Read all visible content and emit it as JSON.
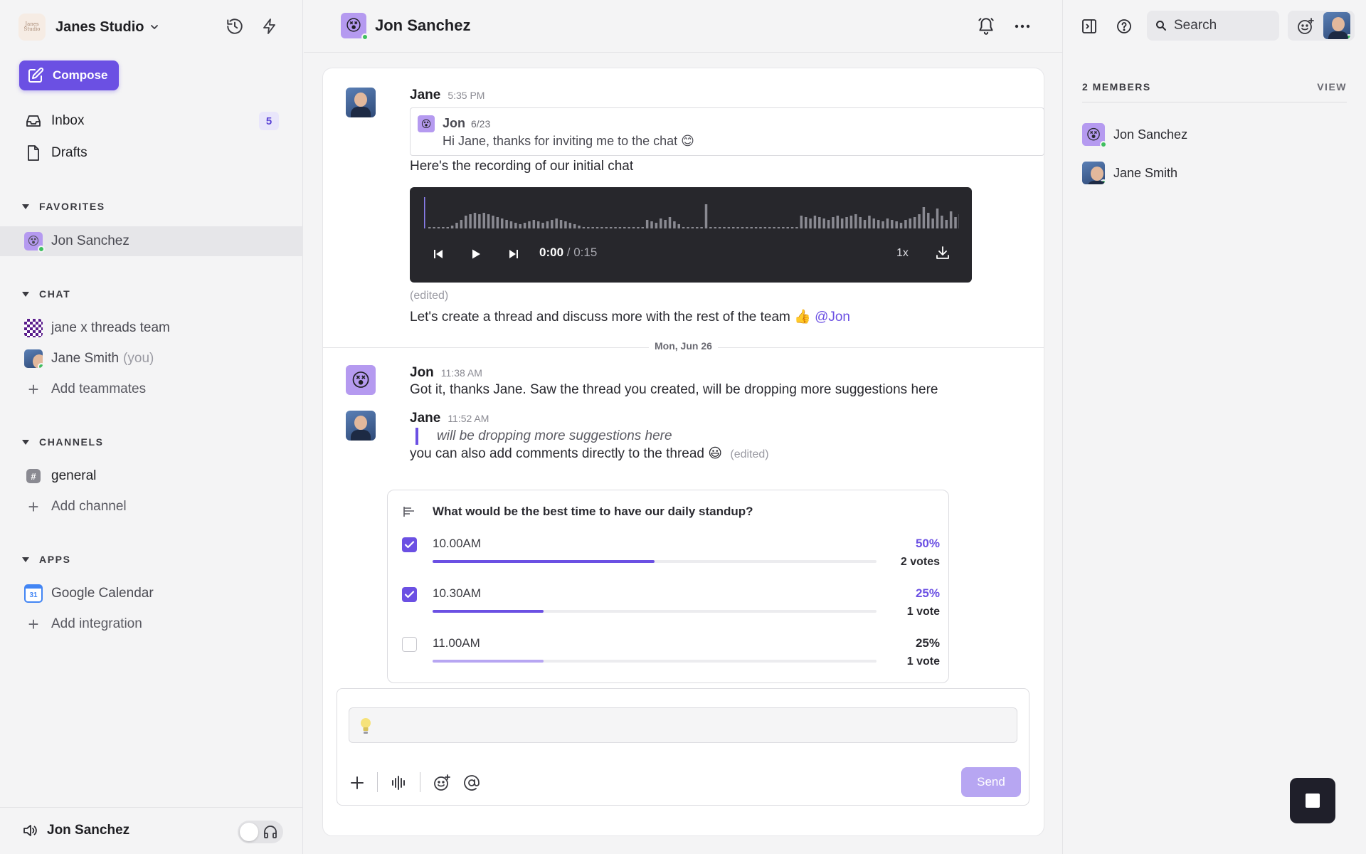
{
  "workspace": {
    "name": "Janes Studio",
    "logo_text": "Janes Studio"
  },
  "compose_label": "Compose",
  "nav": [
    {
      "label": "Inbox",
      "badge": "5"
    },
    {
      "label": "Drafts"
    }
  ],
  "sections": {
    "favorites": "FAVORITES",
    "chat": "CHAT",
    "channels": "CHANNELS",
    "apps": "APPS"
  },
  "favorites": [
    {
      "label": "Jon Sanchez"
    }
  ],
  "chats": [
    {
      "label": "jane x threads team"
    },
    {
      "label": "Jane Smith",
      "suffix": "(you)"
    }
  ],
  "add_teammates": "Add teammates",
  "channels": [
    {
      "label": "general"
    }
  ],
  "add_channel": "Add channel",
  "apps": [
    {
      "label": "Google Calendar",
      "icon_text": "31"
    }
  ],
  "add_integration": "Add integration",
  "footer": {
    "user": "Jon Sanchez"
  },
  "conversation": {
    "title": "Jon Sanchez"
  },
  "messages": {
    "m1": {
      "author": "Jane",
      "time": "5:35 PM",
      "quote": {
        "author": "Jon",
        "date": "6/23",
        "text": "Hi Jane, thanks for inviting me to the chat 😊"
      },
      "text": "Here's the recording of our initial chat",
      "player": {
        "current": "0:00",
        "total": "/ 0:15",
        "speed": "1x"
      },
      "edited": "(edited)",
      "text2": "Let's create a thread and discuss more with the rest of the team 👍",
      "mention": "@Jon"
    },
    "date_divider": "Mon, Jun 26",
    "m2": {
      "author": "Jon",
      "time": "11:38 AM",
      "text": "Got it, thanks Jane. Saw the thread you created, will be dropping more suggestions here"
    },
    "m3": {
      "author": "Jane",
      "time": "11:52 AM",
      "quote": "will be dropping more suggestions here",
      "text": "you can also add comments directly to the thread 😃",
      "edited": "(edited)"
    }
  },
  "poll": {
    "question": "What would be the best time to have our daily standup?",
    "options": [
      {
        "label": "10.00AM",
        "percent": "50%",
        "votes": "2 votes",
        "checked": true,
        "fraction": 0.5
      },
      {
        "label": "10.30AM",
        "percent": "25%",
        "votes": "1 vote",
        "checked": true,
        "fraction": 0.25
      },
      {
        "label": "11.00AM",
        "percent": "25%",
        "votes": "1 vote",
        "checked": false,
        "fraction": 0.25
      }
    ]
  },
  "composer": {
    "send_label": "Send",
    "placeholder_icon": "lightbulb-icon"
  },
  "right_panel": {
    "search_placeholder": "Search",
    "members_title": "2 MEMBERS",
    "view_label": "VIEW",
    "members": [
      {
        "name": "Jon Sanchez"
      },
      {
        "name": "Jane Smith"
      }
    ]
  },
  "colors": {
    "accent": "#6b50e3",
    "accent_light": "#b7a6f2",
    "online": "#3fbf5f",
    "player_bg": "#27272c"
  }
}
